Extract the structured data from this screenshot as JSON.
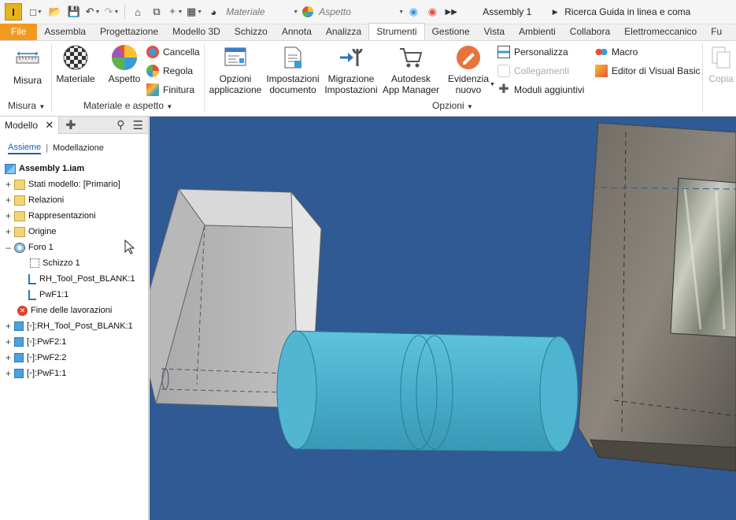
{
  "qat": {
    "logo": "I",
    "material": "Materiale",
    "appearance": "Aspetto",
    "doc_title": "Assembly 1",
    "search": "Ricerca Guida in linea e comandi"
  },
  "tabs": [
    {
      "label": "File"
    },
    {
      "label": "Assembla"
    },
    {
      "label": "Progettazione"
    },
    {
      "label": "Modello 3D"
    },
    {
      "label": "Schizzo"
    },
    {
      "label": "Annota"
    },
    {
      "label": "Analizza"
    },
    {
      "label": "Strumenti"
    },
    {
      "label": "Gestione"
    },
    {
      "label": "Vista"
    },
    {
      "label": "Ambienti"
    },
    {
      "label": "Collabora"
    },
    {
      "label": "Elettromeccanico"
    },
    {
      "label": "Fu"
    }
  ],
  "ribbon": {
    "misura": "Misura",
    "materiale": "Materiale",
    "aspetto": "Aspetto",
    "cancella": "Cancella",
    "regola": "Regola",
    "finitura": "Finitura",
    "opzioni1": "Opzioni",
    "opzioni2": "applicazione",
    "impost1": "Impostazioni",
    "impost2": "documento",
    "migr1": "Migrazione",
    "migr2": "Impostazioni",
    "auto1": "Autodesk",
    "auto2": "App Manager",
    "evid1": "Evidenzia",
    "evid2": "nuovo",
    "personalizza": "Personalizza",
    "collegamenti": "Collegamenti",
    "moduli": "Moduli aggiuntivi",
    "macro": "Macro",
    "editor": "Editor di Visual Basic",
    "copia": "Copia",
    "grp_misura": "Misura",
    "grp_materiale": "Materiale e aspetto",
    "grp_opzioni": "Opzioni"
  },
  "browser": {
    "title": "Modello",
    "tab_assieme": "Assieme",
    "tab_modellazione": "Modellazione",
    "nodes": [
      {
        "label": "Assembly 1.iam"
      },
      {
        "label": "Stati modello: [Primario]"
      },
      {
        "label": "Relazioni"
      },
      {
        "label": "Rappresentazioni"
      },
      {
        "label": "Origine"
      },
      {
        "label": "Foro 1"
      },
      {
        "label": "Schizzo 1"
      },
      {
        "label": "RH_Tool_Post_BLANK:1"
      },
      {
        "label": "PwF1:1"
      },
      {
        "label": "Fine delle lavorazioni"
      },
      {
        "label": "[◦]:RH_Tool_Post_BLANK:1"
      },
      {
        "label": "[◦]:PwF2:1"
      },
      {
        "label": "[◦]:PwF2:2"
      },
      {
        "label": "[◦]:PwF1:1"
      }
    ]
  },
  "colors": {
    "accent": "#f29a1f",
    "viewport_bg": "#2f5a94",
    "cylinder": "#4fb4cf"
  }
}
